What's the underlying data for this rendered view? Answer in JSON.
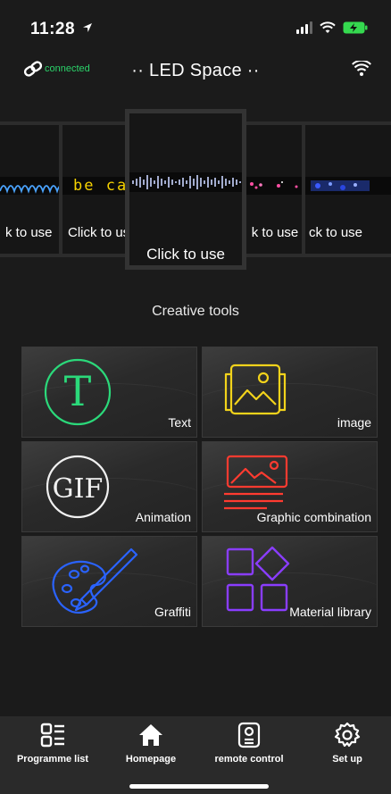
{
  "status_bar": {
    "time": "11:28"
  },
  "header": {
    "connection_status": "connected",
    "title": "·· LED Space ··"
  },
  "carousel": {
    "cards": [
      {
        "caption": "k to use"
      },
      {
        "caption": "Click to use",
        "marquee": "be ca"
      },
      {
        "caption": "Click to use"
      },
      {
        "caption": "k to use"
      },
      {
        "caption": "ck to use"
      }
    ]
  },
  "creative_tools": {
    "title": "Creative tools",
    "items": [
      {
        "label": "Text",
        "icon": "text-t-icon",
        "color": "#2bd97a"
      },
      {
        "label": "image",
        "icon": "image-icon",
        "color": "#f2d31b"
      },
      {
        "label": "Animation",
        "icon": "gif-icon",
        "color": "#f0f0f0"
      },
      {
        "label": "Graphic combination",
        "icon": "graphic-combination-icon",
        "color": "#ff3b30"
      },
      {
        "label": "Graffiti",
        "icon": "palette-icon",
        "color": "#2a63ff"
      },
      {
        "label": "Material library",
        "icon": "material-shapes-icon",
        "color": "#8a3dff"
      }
    ]
  },
  "bottom_nav": {
    "items": [
      {
        "label": "Programme list",
        "icon": "list-icon"
      },
      {
        "label": "Homepage",
        "icon": "home-icon",
        "active": true
      },
      {
        "label": "remote control",
        "icon": "remote-icon"
      },
      {
        "label": "Set up",
        "icon": "gear-icon"
      }
    ]
  },
  "colors": {
    "background": "#1b1b1b",
    "connected": "#2bd36a",
    "nav_bg": "#2a2a2a",
    "battery": "#35d94f"
  }
}
